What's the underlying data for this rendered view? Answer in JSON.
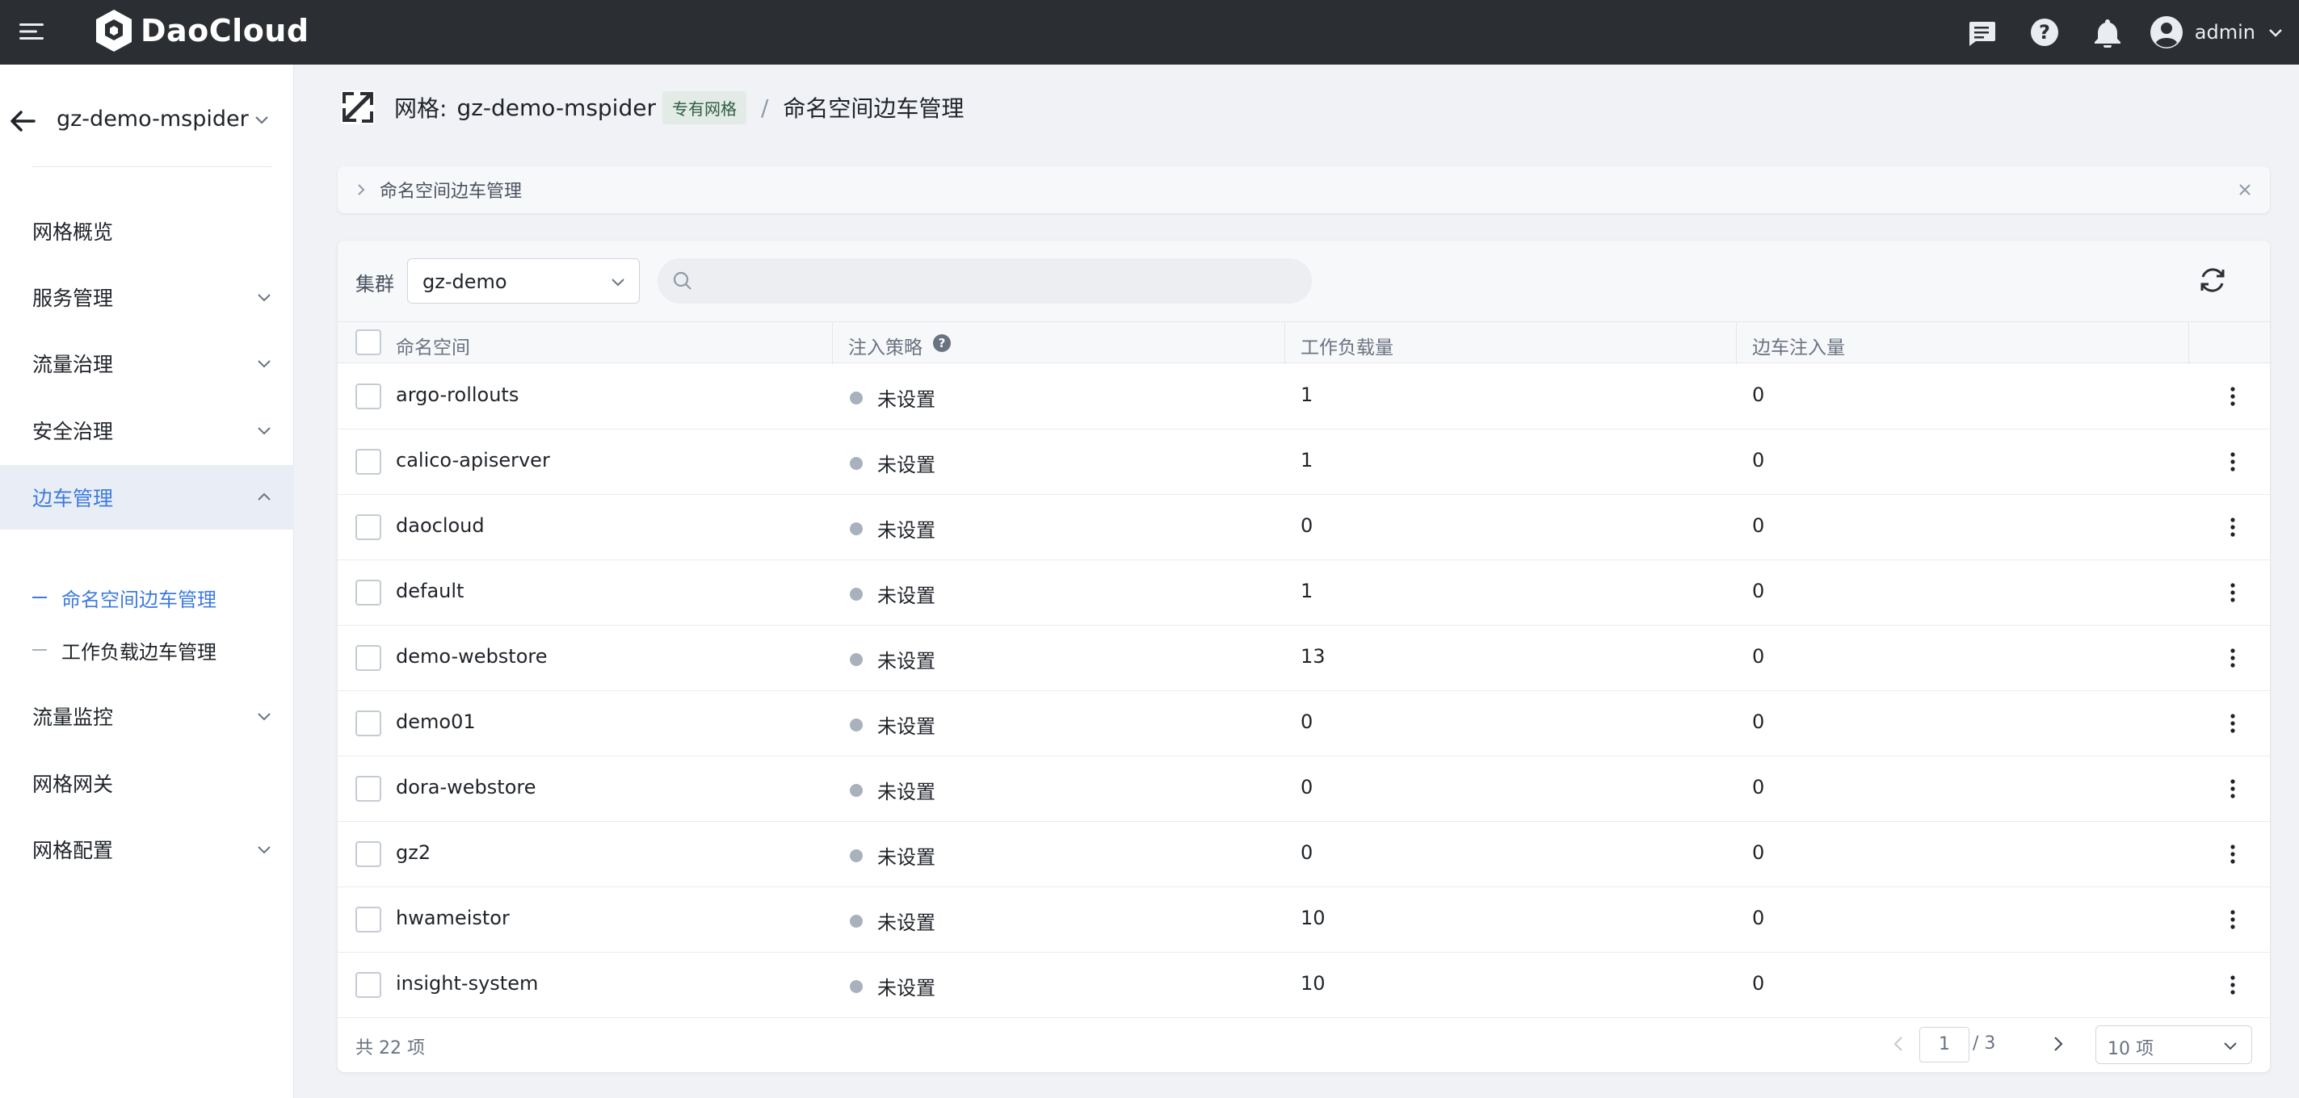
{
  "app": {
    "brand": "DaoCloud",
    "user": "admin"
  },
  "sidebar": {
    "mesh": "gz-demo-mspider",
    "items": [
      {
        "label": "网格概览",
        "expandable": false
      },
      {
        "label": "服务管理",
        "expandable": true
      },
      {
        "label": "流量治理",
        "expandable": true
      },
      {
        "label": "安全治理",
        "expandable": true
      },
      {
        "label": "边车管理",
        "expandable": true,
        "expanded": true
      },
      {
        "label": "流量监控",
        "expandable": true
      },
      {
        "label": "网格网关",
        "expandable": false
      },
      {
        "label": "网格配置",
        "expandable": true
      }
    ],
    "subitems": [
      {
        "label": "命名空间边车管理",
        "active": true
      },
      {
        "label": "工作负载边车管理",
        "active": false
      }
    ]
  },
  "header": {
    "prefix": "网格:",
    "mesh": "gz-demo-mspider",
    "tag": "专有网格",
    "separator": "/",
    "page": "命名空间边车管理"
  },
  "banner": {
    "text": "命名空间边车管理"
  },
  "toolbar": {
    "cluster_label": "集群",
    "cluster_value": "gz-demo",
    "search_placeholder": ""
  },
  "table": {
    "columns": [
      "命名空间",
      "注入策略",
      "工作负载量",
      "边车注入量"
    ],
    "rows": [
      {
        "namespace": "argo-rollouts",
        "policy": "未设置",
        "workloads": "1",
        "sidecars": "0"
      },
      {
        "namespace": "calico-apiserver",
        "policy": "未设置",
        "workloads": "1",
        "sidecars": "0"
      },
      {
        "namespace": "daocloud",
        "policy": "未设置",
        "workloads": "0",
        "sidecars": "0"
      },
      {
        "namespace": "default",
        "policy": "未设置",
        "workloads": "1",
        "sidecars": "0"
      },
      {
        "namespace": "demo-webstore",
        "policy": "未设置",
        "workloads": "13",
        "sidecars": "0"
      },
      {
        "namespace": "demo01",
        "policy": "未设置",
        "workloads": "0",
        "sidecars": "0"
      },
      {
        "namespace": "dora-webstore",
        "policy": "未设置",
        "workloads": "0",
        "sidecars": "0"
      },
      {
        "namespace": "gz2",
        "policy": "未设置",
        "workloads": "0",
        "sidecars": "0"
      },
      {
        "namespace": "hwameistor",
        "policy": "未设置",
        "workloads": "10",
        "sidecars": "0"
      },
      {
        "namespace": "insight-system",
        "policy": "未设置",
        "workloads": "10",
        "sidecars": "0"
      }
    ]
  },
  "footer": {
    "total": "共 22 项",
    "page": "1",
    "pages": "/ 3",
    "page_size": "10 项"
  },
  "colors": {
    "accent": "#3d7ae0",
    "topbar": "#2b2e33",
    "status_dot": "#a9b1bd"
  }
}
